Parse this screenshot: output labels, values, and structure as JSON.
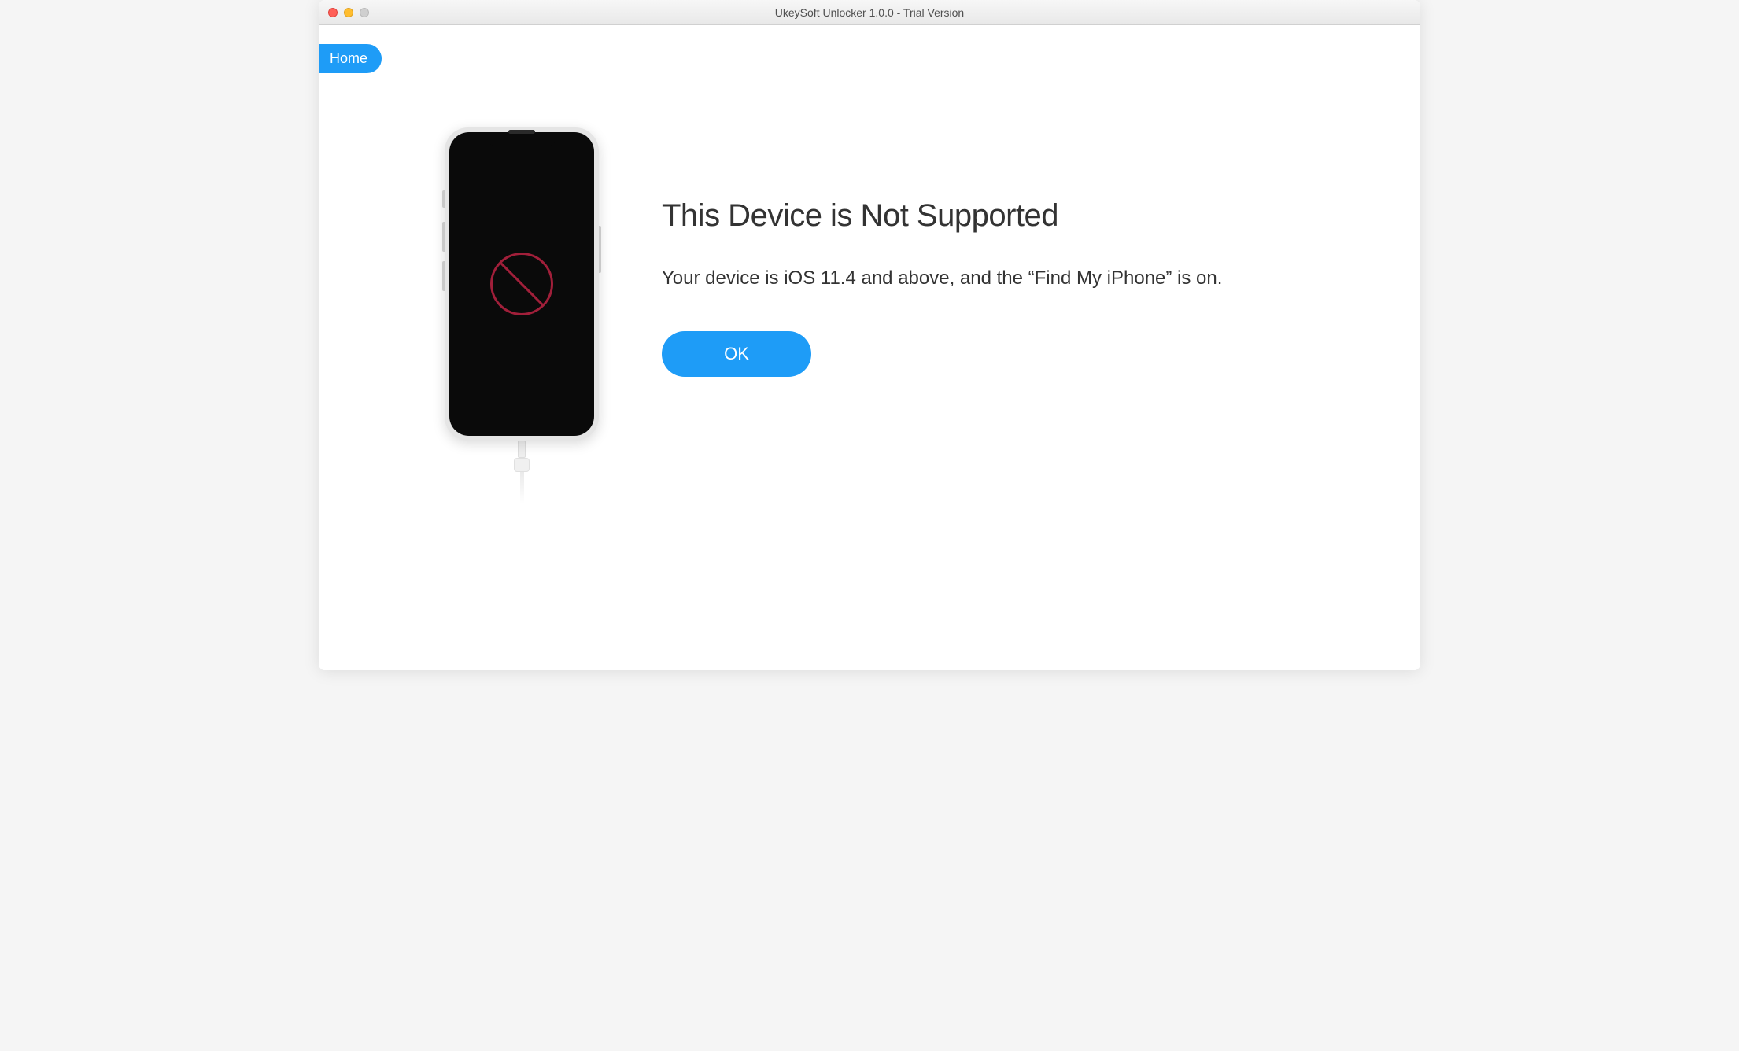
{
  "titlebar": {
    "title": "UkeySoft Unlocker 1.0.0 - Trial Version"
  },
  "nav": {
    "home_label": "Home"
  },
  "message": {
    "heading": "This Device is Not Supported",
    "subtext": "Your device is iOS 11.4 and above, and the “Find My iPhone” is on.",
    "ok_label": "OK"
  }
}
